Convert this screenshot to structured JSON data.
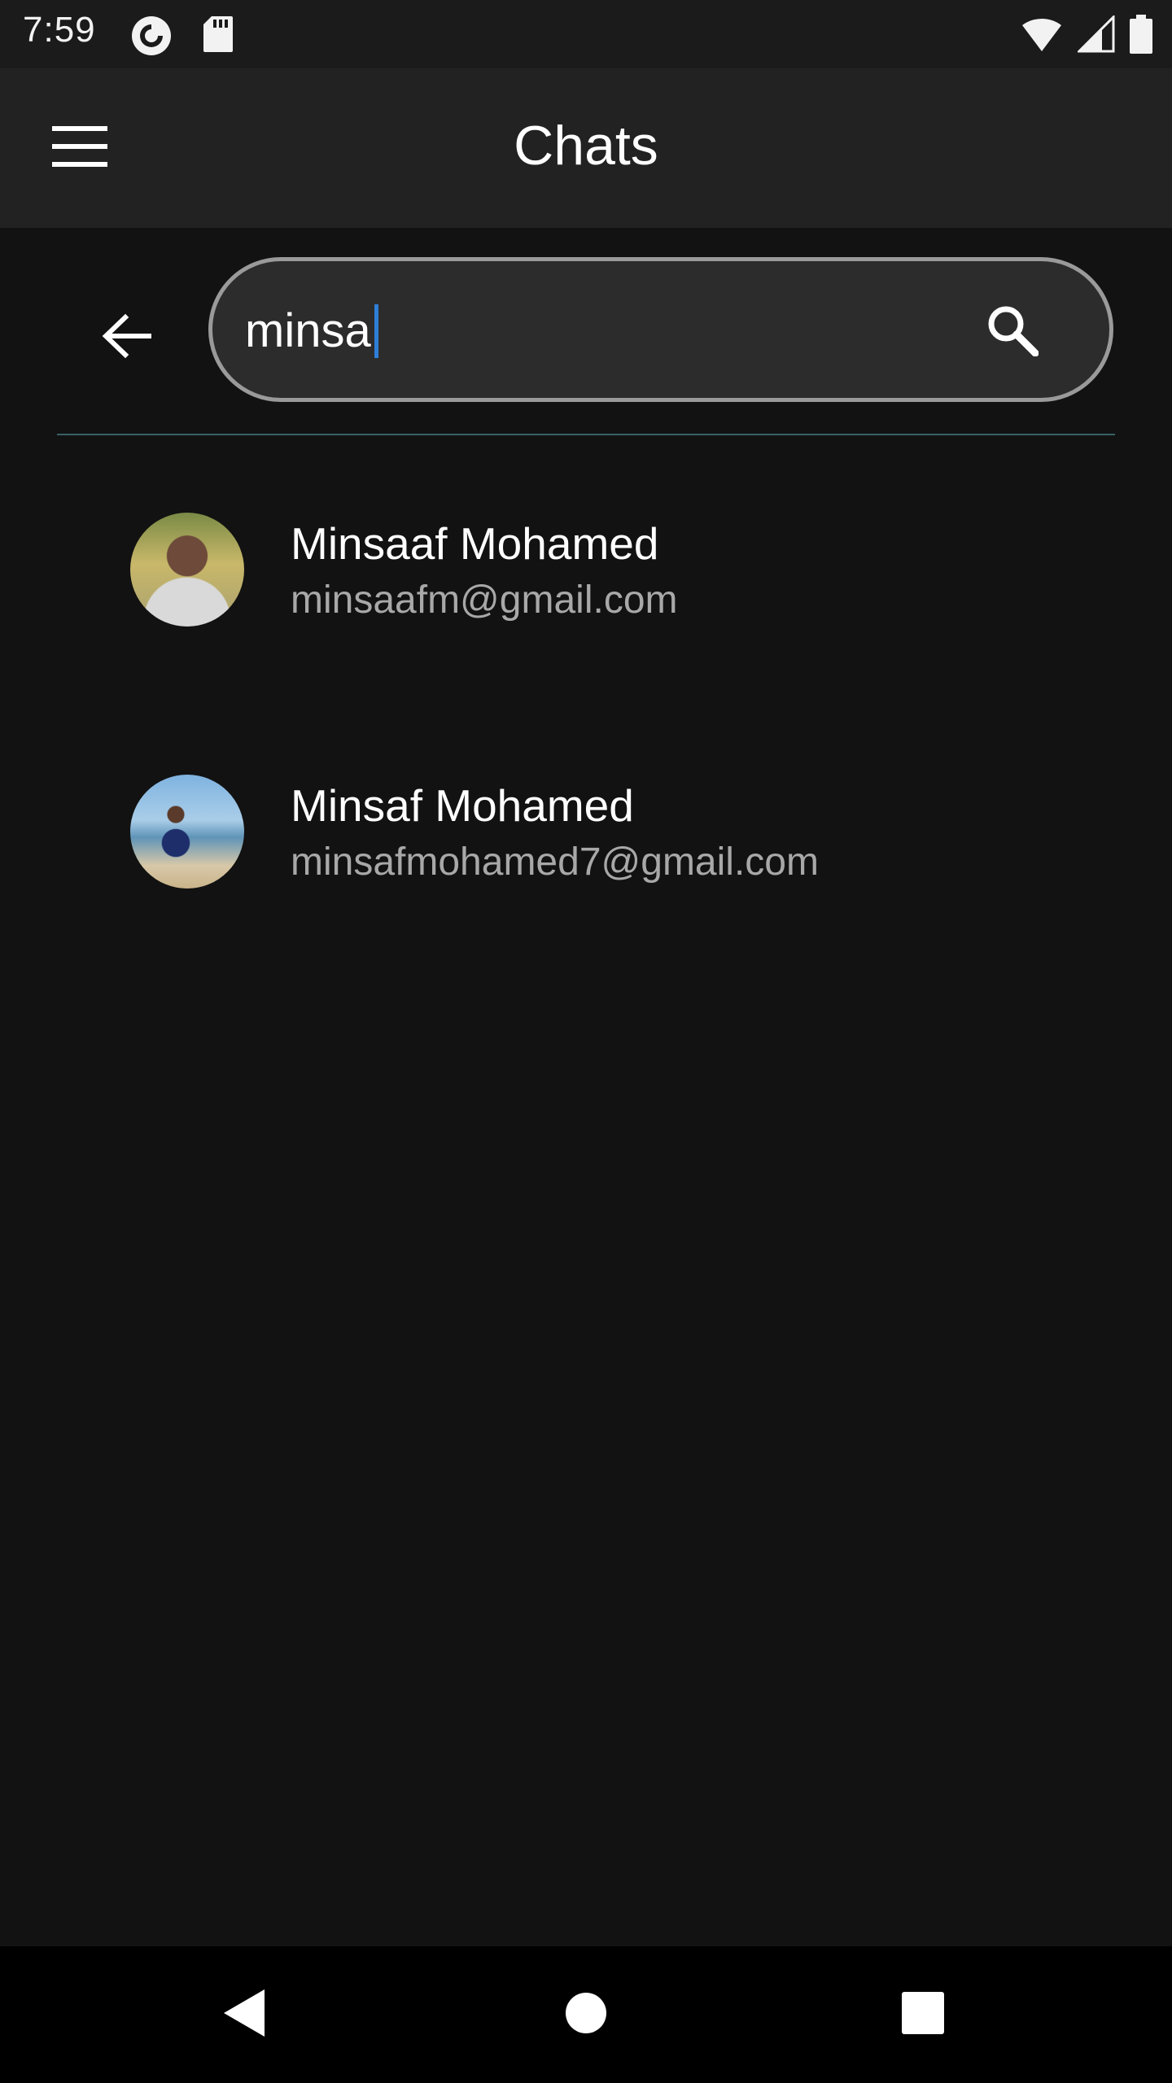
{
  "status_bar": {
    "time": "7:59",
    "left_icons": [
      "pocket-casts-icon",
      "sd-card-icon"
    ],
    "right_icons": [
      "wifi-icon",
      "cell-signal-icon",
      "battery-icon"
    ]
  },
  "app_bar": {
    "title": "Chats",
    "menu_icon": "hamburger-menu-icon"
  },
  "search": {
    "value": "minsa",
    "back_icon": "arrow-back-icon",
    "search_icon": "search-icon"
  },
  "results": [
    {
      "name": "Minsaaf Mohamed",
      "email": "minsaafm@gmail.com"
    },
    {
      "name": "Minsaf Mohamed",
      "email": "minsafmohamed7@gmail.com"
    }
  ],
  "nav_bar": {
    "icons": [
      "back-triangle-icon",
      "home-circle-icon",
      "recents-square-icon"
    ]
  },
  "colors": {
    "background": "#121212",
    "app_bar": "#222222",
    "caret": "#2f7fd8",
    "secondary_text": "#a8a8a8"
  }
}
